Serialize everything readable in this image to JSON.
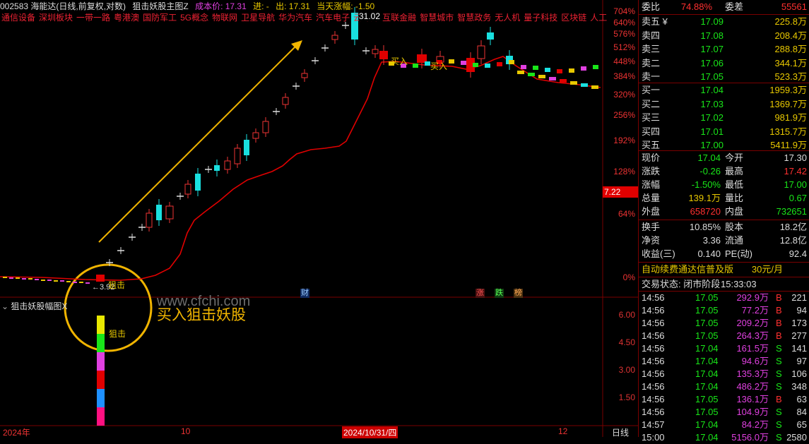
{
  "header": {
    "stock_title": "002583 海能达(日线,前复权,对数)",
    "indicator_title": "狙击妖股主图Z",
    "cost_label": "成本价: 17.31",
    "in_label": "进: -",
    "out_label": "出: 17.31",
    "gain_label": "当天涨幅: -1.50"
  },
  "concepts": [
    "通信设备",
    "深圳板块",
    "一带一路",
    "粤港澳",
    "国防军工",
    "5G概念",
    "物联网",
    "卫星导航",
    "华为汽车",
    "汽车电子",
    "云计算",
    "互联金融",
    "智慧城市",
    "智慧政务",
    "无人机",
    "量子科技",
    "区块链",
    "人工"
  ],
  "price_axis": [
    "704%",
    "640%",
    "576%",
    "512%",
    "448%",
    "384%",
    "320%",
    "256%",
    "192%",
    "128%",
    "64%",
    "0%"
  ],
  "current_label": "7.22",
  "peak_label": "31.02",
  "low_label": "3.92",
  "annotations": {
    "sniper_main": "狙击",
    "buy1": "买入",
    "buy2": "买入",
    "cai": "财",
    "zhang": "涨",
    "die": "跌",
    "bang": "榜",
    "watermark": "www.cfchi.com",
    "callout": "买入狙击妖股"
  },
  "sub_panel": {
    "title": "狙击妖股幅图X",
    "sniper_label": "狙击",
    "axis": [
      "6.00",
      "4.50",
      "3.00",
      "1.50"
    ]
  },
  "footer": {
    "year": "2024年",
    "m10": "10",
    "date": "2024/10/31/四",
    "m12": "12",
    "period": "日线"
  },
  "order_book": {
    "weibi_label": "委比",
    "weibi_value": "74.88%",
    "weicha_label": "委差",
    "weicha_value": "55561",
    "asks": [
      {
        "label": "卖五 ¥",
        "price": "17.09",
        "vol": "225.8万"
      },
      {
        "label": "卖四",
        "price": "17.08",
        "vol": "208.4万"
      },
      {
        "label": "卖三",
        "price": "17.07",
        "vol": "288.8万"
      },
      {
        "label": "卖二",
        "price": "17.06",
        "vol": "344.1万"
      },
      {
        "label": "卖一",
        "price": "17.05",
        "vol": "523.3万"
      }
    ],
    "bids": [
      {
        "label": "买一",
        "price": "17.04",
        "vol": "1959.3万"
      },
      {
        "label": "买二",
        "price": "17.03",
        "vol": "1369.7万"
      },
      {
        "label": "买三",
        "price": "17.02",
        "vol": "981.9万"
      },
      {
        "label": "买四",
        "price": "17.01",
        "vol": "1315.7万"
      },
      {
        "label": "买五",
        "price": "17.00",
        "vol": "5411.9万"
      }
    ]
  },
  "quote": [
    {
      "l1": "现价",
      "v1": "17.04",
      "l2": "今开",
      "v2": "17.30",
      "c1": "green",
      "c2": "white"
    },
    {
      "l1": "涨跌",
      "v1": "-0.26",
      "l2": "最高",
      "v2": "17.42",
      "c1": "green",
      "c2": "red"
    },
    {
      "l1": "涨幅",
      "v1": "-1.50%",
      "l2": "最低",
      "v2": "17.00",
      "c1": "green",
      "c2": "green"
    },
    {
      "l1": "总量",
      "v1": "139.1万",
      "l2": "量比",
      "v2": "0.67",
      "c1": "yellow",
      "c2": "green"
    },
    {
      "l1": "外盘",
      "v1": "658720",
      "l2": "内盘",
      "v2": "732651",
      "c1": "red",
      "c2": "green"
    }
  ],
  "finance": [
    {
      "l1": "换手",
      "v1": "10.85%",
      "l2": "股本",
      "v2": "18.2亿"
    },
    {
      "l1": "净资",
      "v1": "3.36",
      "l2": "流通",
      "v2": "12.8亿"
    },
    {
      "l1": "收益(三)",
      "v1": "0.140",
      "l2": "PE(动)",
      "v2": "92.4"
    }
  ],
  "promo": {
    "text": "自动续费通达信普及版",
    "price": "30元/月"
  },
  "status": {
    "label": "交易状态: 闭市阶段",
    "time": "15:33:03"
  },
  "ticks": [
    {
      "t": "14:56",
      "p": "17.05",
      "v": "292.9万",
      "s": "B",
      "n": "221"
    },
    {
      "t": "14:56",
      "p": "17.05",
      "v": "77.2万",
      "s": "B",
      "n": "94"
    },
    {
      "t": "14:56",
      "p": "17.05",
      "v": "209.2万",
      "s": "B",
      "n": "173"
    },
    {
      "t": "14:56",
      "p": "17.05",
      "v": "264.3万",
      "s": "B",
      "n": "277"
    },
    {
      "t": "14:56",
      "p": "17.04",
      "v": "161.5万",
      "s": "S",
      "n": "141"
    },
    {
      "t": "14:56",
      "p": "17.04",
      "v": "94.6万",
      "s": "S",
      "n": "97"
    },
    {
      "t": "14:56",
      "p": "17.04",
      "v": "135.3万",
      "s": "S",
      "n": "106"
    },
    {
      "t": "14:56",
      "p": "17.04",
      "v": "486.2万",
      "s": "S",
      "n": "348"
    },
    {
      "t": "14:56",
      "p": "17.05",
      "v": "136.1万",
      "s": "B",
      "n": "63"
    },
    {
      "t": "14:56",
      "p": "17.05",
      "v": "104.9万",
      "s": "S",
      "n": "84"
    },
    {
      "t": "14:57",
      "p": "17.04",
      "v": "84.2万",
      "s": "S",
      "n": "65"
    },
    {
      "t": "15:00",
      "p": "17.04",
      "v": "5156.0万",
      "s": "S",
      "n": "2580"
    }
  ],
  "colors": {
    "up": "#ff3030",
    "down": "#19e0e0",
    "border": "#7a0000",
    "accent": "#f0b400"
  }
}
